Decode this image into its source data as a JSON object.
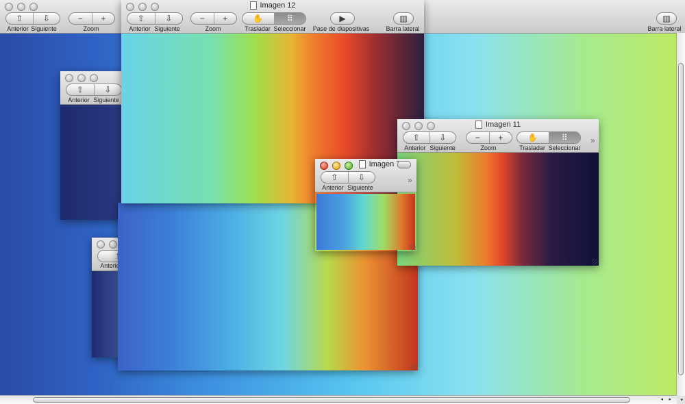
{
  "icons": {
    "up": "⇧",
    "down": "⇩",
    "minus": "−",
    "plus": "+",
    "hand": "✋",
    "select": "⠿",
    "slideshow": "▶",
    "sidebar": "▥",
    "chevron": "»",
    "arrow_left": "◂",
    "arrow_right": "▸",
    "arrow_up": "▴",
    "arrow_down": "▾"
  },
  "main_window": {
    "toolbar": {
      "anterior": "Anterior",
      "siguiente": "Siguiente",
      "zoom": "Zoom",
      "sidebar": "Barra lateral"
    }
  },
  "window12": {
    "title": "Imagen 12",
    "toolbar": {
      "anterior": "Anterior",
      "siguiente": "Siguiente",
      "zoom": "Zoom",
      "trasladar": "Trasladar",
      "seleccionar": "Seleccionar",
      "slideshow": "Pase de diapositivas",
      "sidebar": "Barra lateral"
    }
  },
  "window11": {
    "title": "Imagen 11",
    "toolbar": {
      "anterior": "Anterior",
      "siguiente": "Siguiente",
      "zoom": "Zoom",
      "trasladar": "Trasladar",
      "seleccionar": "Seleccionar"
    }
  },
  "window7": {
    "title": "Imagen 7",
    "toolbar": {
      "anterior": "Anterior",
      "siguiente": "Siguiente"
    }
  },
  "back_window_a": {
    "toolbar": {
      "anterior": "Anterior",
      "siguiente": "Siguiente"
    }
  },
  "back_window_b": {
    "toolbar": {
      "anterior": "Anterior"
    }
  }
}
